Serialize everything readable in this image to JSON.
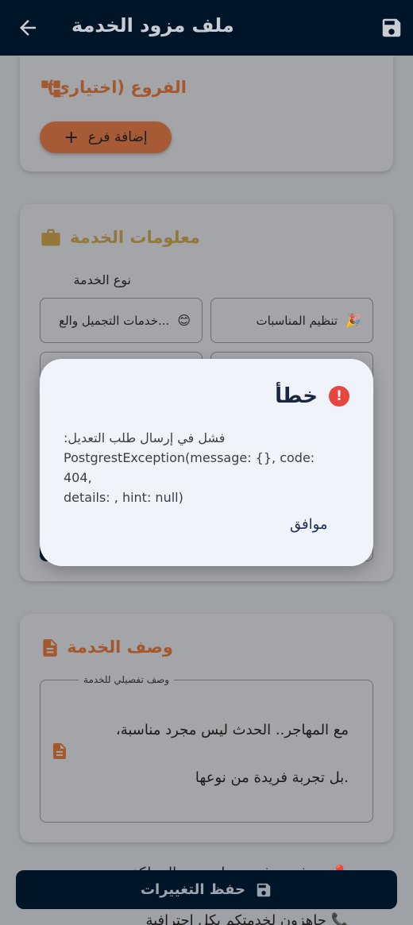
{
  "appbar": {
    "title": "ملف مزود الخدمة"
  },
  "branches": {
    "title": "الفروع (اختياري)",
    "add_button": "إضافة فرع",
    "add_symbol": "+"
  },
  "service_info": {
    "title": "معلومات الخدمة",
    "type_label": "نوع الخدمة",
    "chips": [
      "تنظيم المناسبات",
      "...خدمات التجميل والع"
    ]
  },
  "service_desc": {
    "title": "وصف الخدمة",
    "legend": "وصف تفصيلي للخدمة",
    "text_line1": "مع المهاجر.. الحدث ليس مجرد مناسبة،",
    "text_line2": ".بل تجربة فريدة من نوعها",
    "text_line3": "📍 متوفرون في معظم مدن المملكة",
    "text_line4": "📞 جاهزون لخدمتكم بكل احترافية"
  },
  "save_button": "حفظ التغييرات",
  "dialog": {
    "title": "خطأ",
    "icon": "!",
    "message_line1": "فشل في إرسال طلب التعديل:",
    "message_line2": "PostgrestException(message: {}, code: 404,",
    "message_line3": "details: , hint: null)",
    "ok": "موافق"
  },
  "colors": {
    "appbar": "#001528",
    "accent_orange": "#a65a36",
    "accent_gold": "#94773b",
    "error": "#e6463f"
  }
}
